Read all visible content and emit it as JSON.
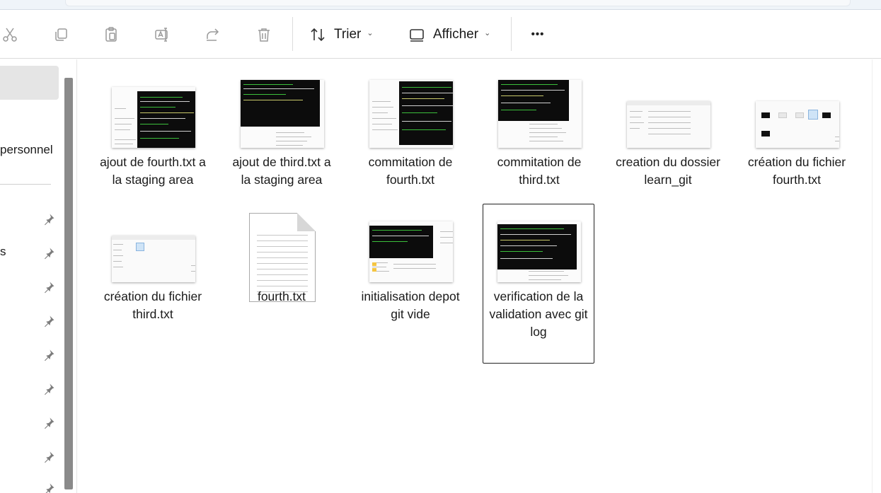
{
  "toolbar": {
    "sort_label": "Trier",
    "view_label": "Afficher",
    "more_label": "•••"
  },
  "nav": {
    "items": [
      {
        "label": "personnel"
      },
      {
        "label": "s"
      }
    ],
    "pinned_count": 8
  },
  "files": [
    {
      "name": "ajout de fourth.txt a la staging area",
      "type": "image"
    },
    {
      "name": "ajout de third.txt a la staging area",
      "type": "image"
    },
    {
      "name": "commitation de fourth.txt",
      "type": "image"
    },
    {
      "name": "commitation de third.txt",
      "type": "image"
    },
    {
      "name": "creation du dossier learn_git",
      "type": "image"
    },
    {
      "name": "création du fichier fourth.txt",
      "type": "image"
    },
    {
      "name": "création du fichier third.txt",
      "type": "image"
    },
    {
      "name": "fourth.txt",
      "type": "text-document"
    },
    {
      "name": "initialisation depot git vide",
      "type": "image"
    },
    {
      "name": "verification de la validation avec git log",
      "type": "image",
      "selected": true
    }
  ]
}
